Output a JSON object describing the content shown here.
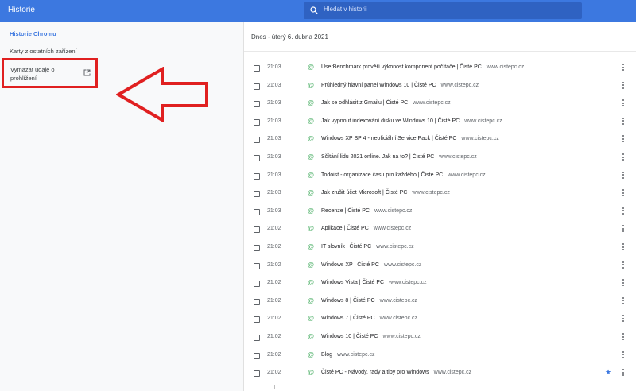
{
  "header": {
    "title": "Historie",
    "search_placeholder": "Hledat v historii"
  },
  "sidebar": {
    "history_label": "Historie Chromu",
    "other_devices_label": "Karty z ostatních zařízení",
    "clear_label": "Vymazat údaje o prohlížení"
  },
  "main": {
    "date_header": "Dnes - úterý 6. dubna 2021",
    "entries": [
      {
        "time": "21:03",
        "title": "UserBenchmark prověří výkonost komponent počítače | Čisté PC",
        "domain": "www.cistepc.cz",
        "starred": false
      },
      {
        "time": "21:03",
        "title": "Průhledný hlavní panel Windows 10 | Čisté PC",
        "domain": "www.cistepc.cz",
        "starred": false
      },
      {
        "time": "21:03",
        "title": "Jak se odhlásit z Gmailu | Čisté PC",
        "domain": "www.cistepc.cz",
        "starred": false
      },
      {
        "time": "21:03",
        "title": "Jak vypnout indexování disku ve Windows 10 | Čisté PC",
        "domain": "www.cistepc.cz",
        "starred": false
      },
      {
        "time": "21:03",
        "title": "Windows XP SP 4 - neoficiální Service Pack | Čisté PC",
        "domain": "www.cistepc.cz",
        "starred": false
      },
      {
        "time": "21:03",
        "title": "Sčítání lidu 2021 online. Jak na to? | Čisté PC",
        "domain": "www.cistepc.cz",
        "starred": false
      },
      {
        "time": "21:03",
        "title": "Todoist - organizace času pro každého | Čisté PC",
        "domain": "www.cistepc.cz",
        "starred": false
      },
      {
        "time": "21:03",
        "title": "Jak zrušit účet Microsoft | Čisté PC",
        "domain": "www.cistepc.cz",
        "starred": false
      },
      {
        "time": "21:03",
        "title": "Recenze | Čisté PC",
        "domain": "www.cistepc.cz",
        "starred": false
      },
      {
        "time": "21:02",
        "title": "Aplikace | Čisté PC",
        "domain": "www.cistepc.cz",
        "starred": false
      },
      {
        "time": "21:02",
        "title": "IT slovník | Čisté PC",
        "domain": "www.cistepc.cz",
        "starred": false
      },
      {
        "time": "21:02",
        "title": "Windows XP | Čisté PC",
        "domain": "www.cistepc.cz",
        "starred": false
      },
      {
        "time": "21:02",
        "title": "Windows Vista | Čisté PC",
        "domain": "www.cistepc.cz",
        "starred": false
      },
      {
        "time": "21:02",
        "title": "Windows 8 | Čisté PC",
        "domain": "www.cistepc.cz",
        "starred": false
      },
      {
        "time": "21:02",
        "title": "Windows 7 | Čisté PC",
        "domain": "www.cistepc.cz",
        "starred": false
      },
      {
        "time": "21:02",
        "title": "Windows 10 | Čisté PC",
        "domain": "www.cistepc.cz",
        "starred": false
      },
      {
        "time": "21:02",
        "title": "Blog",
        "domain": "www.cistepc.cz",
        "starred": false
      },
      {
        "time": "21:02",
        "title": "Čisté PC - Návody, rady a tipy pro Windows",
        "domain": "www.cistepc.cz",
        "starred": true
      }
    ]
  },
  "colors": {
    "accent": "#3c78e0",
    "annotation": "#e02020",
    "favicon": "#3aa757"
  }
}
